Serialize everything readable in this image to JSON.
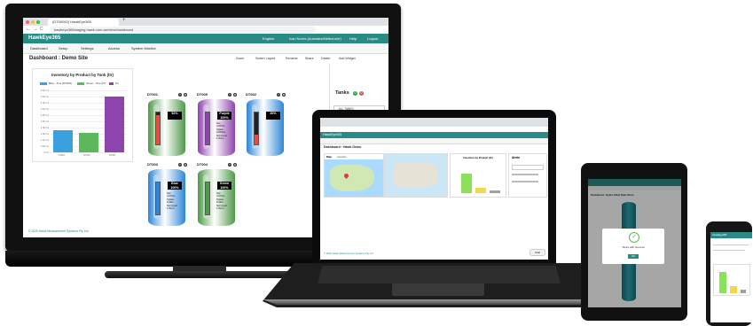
{
  "monitor": {
    "browser": {
      "tab_title": "(DT00082) HawkEye365",
      "url": "hawkeye365staging.hawk.com.au/view/dashboard",
      "back": "←",
      "forward": "→",
      "reload": "C",
      "new_tab": "+"
    },
    "app": {
      "logo": "HawkEye365",
      "language": "English",
      "user": "Ivan Norris (Australia/Melbourne)",
      "help": "Help",
      "logout": "Logout",
      "accent": "#2a8a86"
    },
    "menu": {
      "dashboard": "Dashboard",
      "setup": "Setup",
      "settings": "Settings",
      "access": "Access",
      "system_monitor": "System Monitor"
    },
    "dashboard": {
      "title": "Dashboard : Demo Site",
      "tools": [
        "Zoom",
        "Switch Layout",
        "Rename",
        "Share",
        "Delete",
        "Add Widget"
      ]
    },
    "chart": {
      "title": "Inventory by Product by Tank (ltr)",
      "legend": [
        "Blue - Tins (DT003)",
        "Green - Tins (DT",
        "Pu"
      ]
    },
    "chart_data": {
      "type": "bar",
      "title": "Inventory by Product by Tank (ltr)",
      "categories": [
        "DT003",
        "DT004",
        "DT005"
      ],
      "series": [
        {
          "name": "Blue - Tins (DT003)",
          "color": "#3aa0e0",
          "values": [
            1800
          ]
        },
        {
          "name": "Green - Tins (DT",
          "color": "#5cb85c",
          "values": [
            1600
          ]
        },
        {
          "name": "Pu",
          "color": "#8e44ad",
          "values": [
            4500
          ]
        }
      ],
      "yticks": [
        "5.0k ltrs",
        "4.5k ltrs",
        "4.0k ltrs",
        "3.5k ltrs",
        "3.0k ltrs",
        "2.5k ltrs",
        "2.0k ltrs",
        "1.5k ltrs",
        "1.0k ltrs",
        "0.5k ltrs",
        "0 ltrs"
      ],
      "ylim": [
        0,
        5000
      ],
      "grid": true,
      "legend_position": "top"
    },
    "tanks": [
      {
        "name": "DT001",
        "percent": "92%",
        "fill": 0.92,
        "color": "#4f9a4a",
        "info": "",
        "gauge": "#e74c3c"
      },
      {
        "name": "DT005",
        "percent": "Purple\n100%",
        "fill": 1.0,
        "color": "#8e44ad",
        "info": "Net\n4.67ltrs\nSpace\n0.8%ltrs\nNet Level\n1.8mm",
        "gauge": "#8e44ad"
      },
      {
        "name": "DT002",
        "percent": "30%",
        "fill": 0.3,
        "color": "#2e86d8",
        "info": "",
        "gauge": "#e74c3c"
      },
      {
        "name": "DT003",
        "percent": "Blue\n100%",
        "fill": 1.0,
        "color": "#2e86d8",
        "info": "Net\n4.67ltrs\nSpace\n0.0ltrs\nNet Level\n1.8mm",
        "gauge": "#2e86d8"
      },
      {
        "name": "DT004",
        "percent": "Green\n100%",
        "fill": 1.0,
        "color": "#4f9a4a",
        "info": "Net\n4.67ltrs\nSpace\n0.0ltrs\nNet Level\n1.8mm",
        "gauge": "#4f9a4a"
      }
    ],
    "panel": {
      "title": "Tanks",
      "badge_green": "0",
      "badge_red": "0",
      "all_tanks": "- ALL TANKS -",
      "all_products": "- ALL PRODUCTS -"
    },
    "footer": "© 2020 Hawk Measurement Systems Pty Ltd"
  },
  "laptop": {
    "app_logo": "HawkEye365",
    "dashboard_title": "Dashboard : Hawk Demo",
    "map_tab": "Map",
    "satellite_tab": "Satellite",
    "chart_title": "Inventory by Product (ltr)",
    "alerts_title": "Alerts",
    "footer": "© 2020 Hawk Measurement Systems Pty Ltd",
    "chat_button": "Chat"
  },
  "tablet": {
    "dashboard_title": "Dashboard : Hydro Ethyl Tank Chem",
    "modal_text": "Tanks with success",
    "ok_button": "OK"
  },
  "phone": {
    "logo": "HawkEye365"
  }
}
